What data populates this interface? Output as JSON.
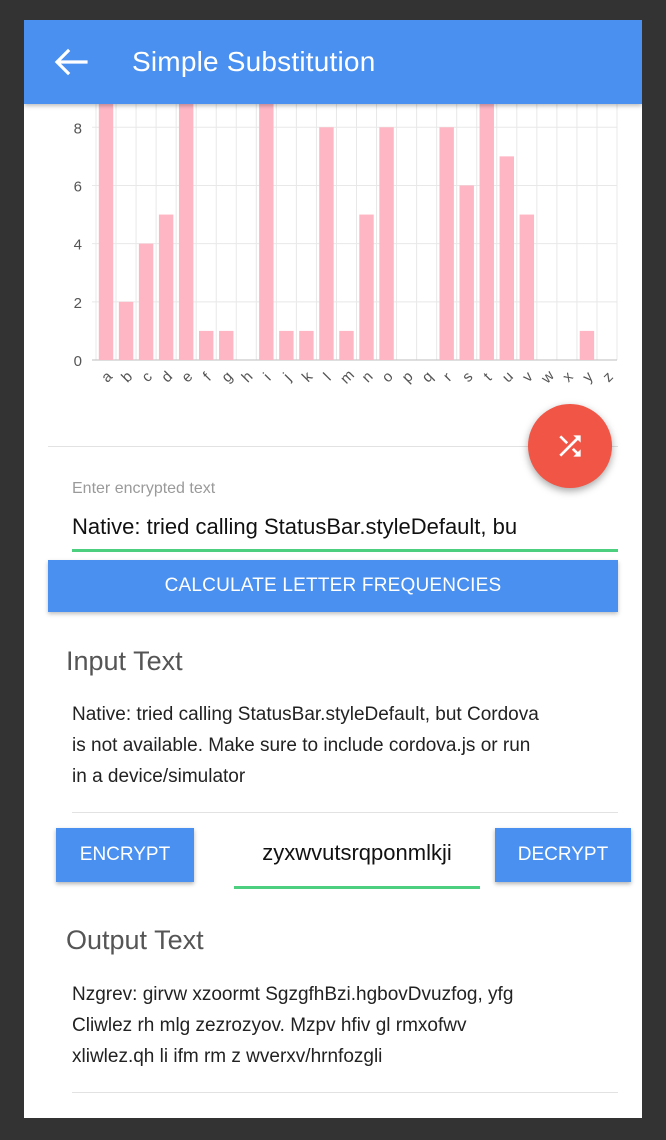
{
  "header": {
    "title": "Simple Substitution",
    "back_icon": "arrow-left-icon"
  },
  "colors": {
    "toolbar": "#4a90f0",
    "bar": "#ffb6c4",
    "fab": "#f05545",
    "input_underline": "#4cd080",
    "button": "#4a90f0"
  },
  "chart_data": {
    "type": "bar",
    "categories": [
      "a",
      "b",
      "c",
      "d",
      "e",
      "f",
      "g",
      "h",
      "i",
      "j",
      "k",
      "l",
      "m",
      "n",
      "o",
      "p",
      "q",
      "r",
      "s",
      "t",
      "u",
      "v",
      "w",
      "x",
      "y",
      "z"
    ],
    "values": [
      9,
      2,
      4,
      5,
      9,
      1,
      1,
      0,
      9,
      1,
      1,
      8,
      1,
      5,
      8,
      0,
      0,
      8,
      6,
      9,
      7,
      5,
      0,
      0,
      1,
      0
    ],
    "y_ticks": [
      "0",
      "2",
      "4",
      "6",
      "8"
    ],
    "ylim": [
      0,
      8.8
    ],
    "grid": true
  },
  "fab": {
    "icon": "shuffle-icon"
  },
  "encrypted_input": {
    "placeholder": "Enter encrypted text",
    "value": "Native: tried calling StatusBar.styleDefault, bu"
  },
  "calc_button": {
    "label": "CALCULATE LETTER FREQUENCIES"
  },
  "input_section": {
    "title": "Input Text",
    "lines": [
      "Native: tried calling StatusBar.styleDefault, but Cordova",
      "is not available. Make sure to include cordova.js or run",
      "in a device/simulator"
    ]
  },
  "cipher_row": {
    "encrypt_label": "ENCRYPT",
    "decrypt_label": "DECRYPT",
    "key_value": "zyxwvutsrqponmlkji"
  },
  "output_section": {
    "title": "Output Text",
    "lines": [
      "Nzgrev: girvw xzoormt SgzgfhBzi.hgbovDvuzfog, yfg",
      "Cliwlez rh mlg zezrozyov. Mzpv hfiv gl rmxofwv",
      "xliwlez.qh li ifm rm z wverxv/hrnfozgli"
    ]
  }
}
